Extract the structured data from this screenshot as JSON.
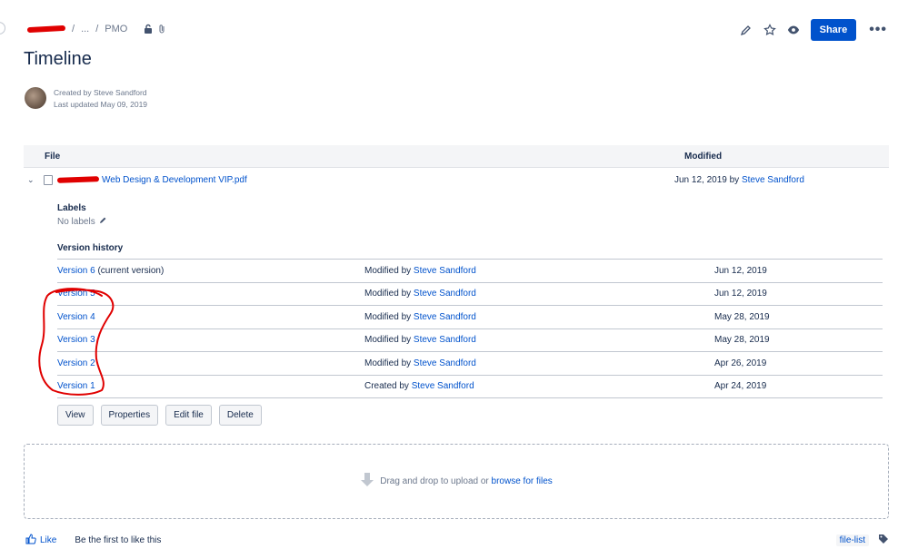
{
  "breadcrumb": {
    "ellipsis": "...",
    "separator": "/",
    "current": "PMO"
  },
  "toolbar": {
    "share_label": "Share",
    "more_label": "•••"
  },
  "page": {
    "title": "Timeline",
    "created_by": "Created by Steve Sandford",
    "last_updated": "Last updated May 09, 2019"
  },
  "table": {
    "col_file": "File",
    "col_modified": "Modified",
    "file": {
      "name": "Web Design & Development VIP.pdf",
      "modified_date": "Jun 12, 2019 by ",
      "modified_by": "Steve Sandford"
    }
  },
  "labels": {
    "heading": "Labels",
    "value": "No labels"
  },
  "version_history": {
    "heading": "Version history",
    "rows": [
      {
        "name": "Version 6",
        "suffix": " (current version)",
        "action": "Modified by ",
        "user": "Steve Sandford",
        "date": "Jun 12, 2019"
      },
      {
        "name": "Version 5",
        "suffix": "",
        "action": "Modified by ",
        "user": "Steve Sandford",
        "date": "Jun 12, 2019"
      },
      {
        "name": "Version 4",
        "suffix": "",
        "action": "Modified by ",
        "user": "Steve Sandford",
        "date": "May 28, 2019"
      },
      {
        "name": "Version 3",
        "suffix": "",
        "action": "Modified by ",
        "user": "Steve Sandford",
        "date": "May 28, 2019"
      },
      {
        "name": "Version 2",
        "suffix": "",
        "action": "Modified by ",
        "user": "Steve Sandford",
        "date": "Apr 26, 2019"
      },
      {
        "name": "Version 1",
        "suffix": "",
        "action": "Created by ",
        "user": "Steve Sandford",
        "date": "Apr 24, 2019"
      }
    ]
  },
  "buttons": {
    "view": "View",
    "properties": "Properties",
    "edit_file": "Edit file",
    "delete": "Delete"
  },
  "dropzone": {
    "text": "Drag and drop to upload or ",
    "link": "browse for files"
  },
  "footer": {
    "like": "Like",
    "like_prompt": "Be the first to like this",
    "label": "file-list"
  },
  "colors": {
    "accent": "#0052cc",
    "redaction": "#e00000",
    "annotation": "#e00000"
  },
  "icons": [
    "lock-open-icon",
    "attachment-icon",
    "edit-icon",
    "star-icon",
    "watch-icon",
    "chevron-down-icon",
    "pdf-file-icon",
    "pencil-icon",
    "upload-arrow-icon",
    "like-icon",
    "tag-icon"
  ]
}
